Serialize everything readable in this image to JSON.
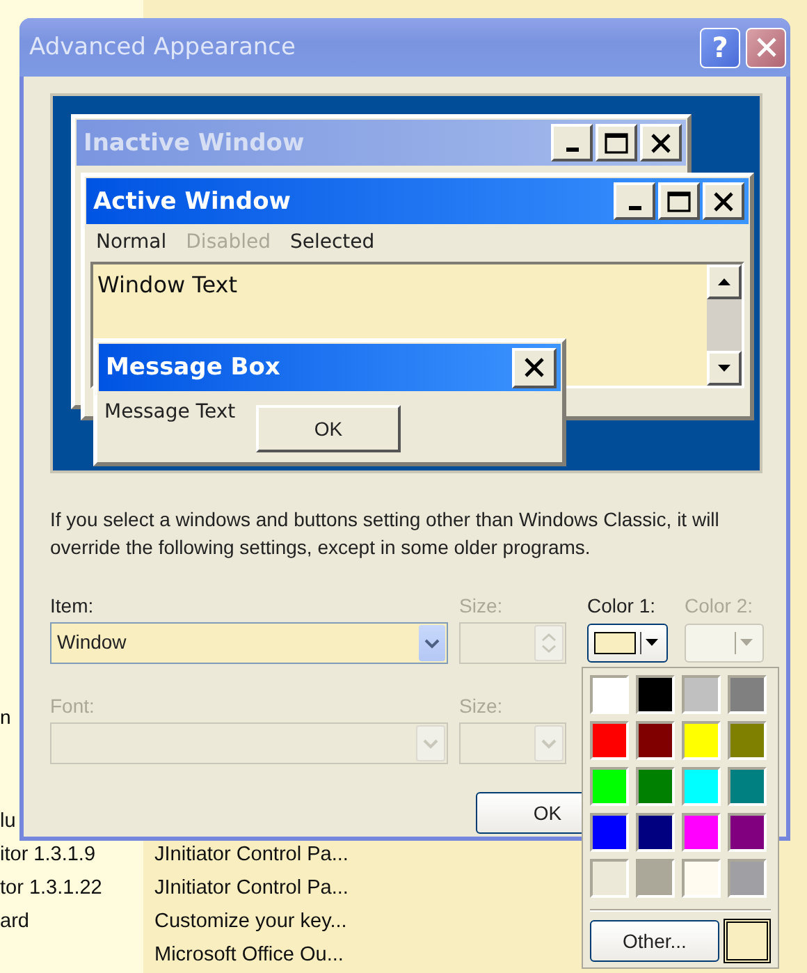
{
  "dialog": {
    "title": "Advanced Appearance",
    "help_button": "?"
  },
  "preview": {
    "inactive_window": {
      "title": "Inactive Window"
    },
    "active_window": {
      "title": "Active Window",
      "menu": [
        {
          "label": "Normal",
          "disabled": false
        },
        {
          "label": "Disabled",
          "disabled": true
        },
        {
          "label": "Selected",
          "disabled": false
        }
      ],
      "text": "Window Text"
    },
    "message_box": {
      "title": "Message Box",
      "text": "Message Text",
      "button": "OK"
    }
  },
  "info": "If you select a windows and buttons setting other than Windows Classic, it will override the following settings, except in some older programs.",
  "item": {
    "label": "Item:",
    "value": "Window",
    "disabled": false
  },
  "item_size": {
    "label": "Size:",
    "disabled": true
  },
  "color_1": {
    "label": "Color 1:",
    "color": "#f8eec0",
    "disabled": false
  },
  "color_2": {
    "label": "Color 2:",
    "disabled": true
  },
  "font": {
    "label": "Font:",
    "disabled": true
  },
  "font_size": {
    "label": "Size:",
    "disabled": true
  },
  "buttons": [
    "OK"
  ],
  "color_palette": {
    "swatches": [
      {
        "color": "#ffffff"
      },
      {
        "color": "#000000"
      },
      {
        "color": "#c0c0c0"
      },
      {
        "color": "#808080"
      },
      {
        "color": "#ff0000"
      },
      {
        "color": "#800000"
      },
      {
        "color": "#ffff00"
      },
      {
        "color": "#808000"
      },
      {
        "color": "#00ff00"
      },
      {
        "color": "#008000"
      },
      {
        "color": "#00ffff"
      },
      {
        "color": "#008080"
      },
      {
        "color": "#0000ff"
      },
      {
        "color": "#000080"
      },
      {
        "color": "#ff00ff"
      },
      {
        "color": "#800080"
      },
      {
        "color": "#ece9d8"
      },
      {
        "color": "#aca899"
      },
      {
        "color": "#fffbf0"
      },
      {
        "color": "#a0a0a4"
      }
    ],
    "other_button": "Other...",
    "current_swatch": {
      "color": "#f8eec0"
    }
  },
  "background_list": {
    "left_text": "n",
    "rows": [
      {
        "column_1": "lu"
      },
      {
        "column_1": "itor 1.3.1.9",
        "column_2": "JInitiator Control Pa..."
      },
      {
        "column_1": "tor 1.3.1.22",
        "column_2": "JInitiator Control Pa..."
      },
      {
        "column_1": "ard",
        "column_2": "Customize your key..."
      },
      {
        "column_2": "Microsoft Office Ou..."
      }
    ]
  }
}
